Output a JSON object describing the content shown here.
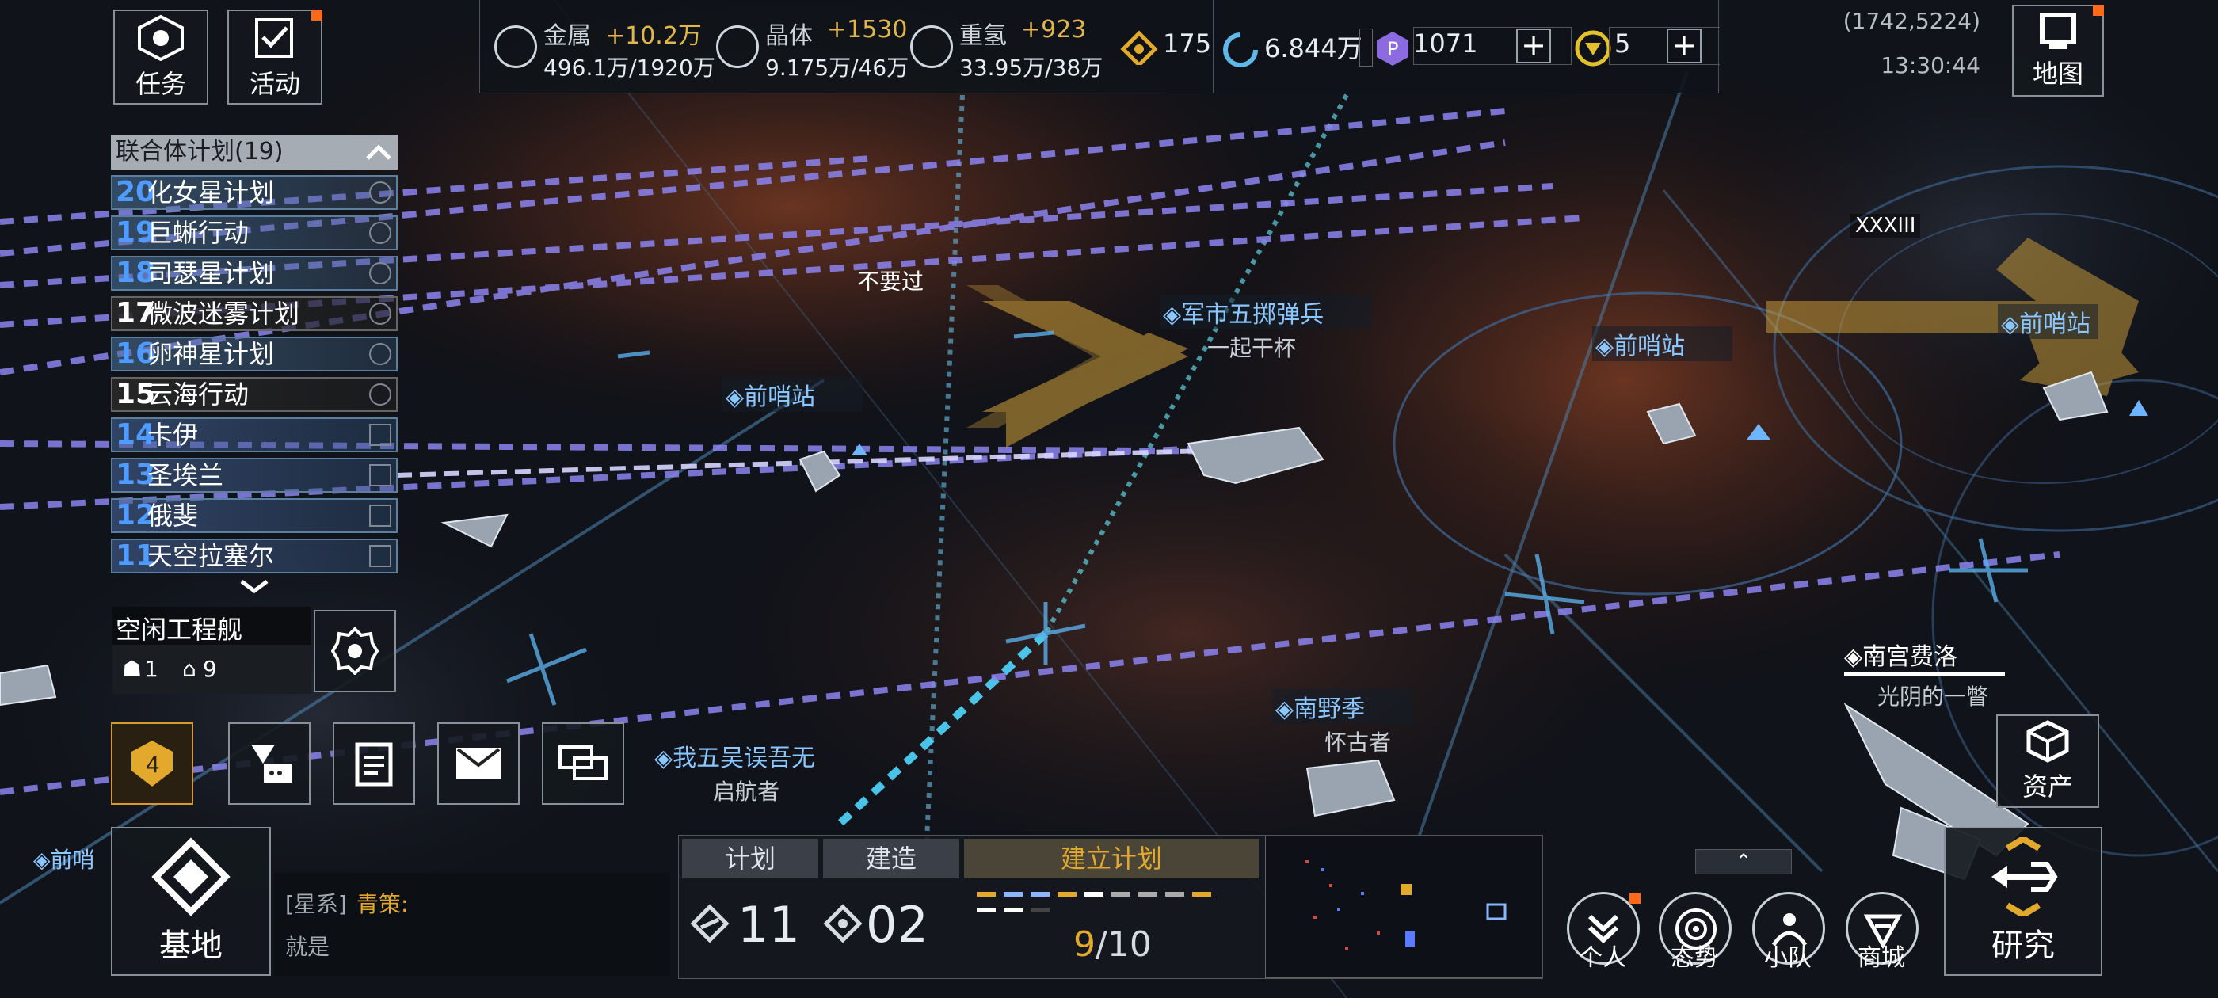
{
  "topleft": {
    "task_label": "任务",
    "activity_label": "活动"
  },
  "resources": [
    {
      "name": "金属",
      "delta": "+10.2万",
      "amount": "496.1万/1920万"
    },
    {
      "name": "晶体",
      "delta": "+1530",
      "amount": "9.175万/46万"
    },
    {
      "name": "重氢",
      "delta": "+923",
      "amount": "33.95万/38万"
    }
  ],
  "currencies": {
    "c1": "175",
    "c2": "6.844万",
    "c3": "1071",
    "c4": "5"
  },
  "coords": {
    "position": "(1742,5224)",
    "time": "13:30:44"
  },
  "map_button_label": "地图",
  "plan_list": {
    "header": "联合体计划(19)",
    "items": [
      {
        "num": "20",
        "name": "化女星计划"
      },
      {
        "num": "19",
        "name": "巨蜥行动"
      },
      {
        "num": "18",
        "name": "司瑟星计划"
      },
      {
        "num": "17",
        "name": "微波迷雾计划"
      },
      {
        "num": "16",
        "name": "卵神星计划"
      },
      {
        "num": "15",
        "name": "云海行动"
      },
      {
        "num": "14",
        "name": "卡伊"
      },
      {
        "num": "13",
        "name": "圣埃兰"
      },
      {
        "num": "12",
        "name": "俄斐"
      },
      {
        "num": "11",
        "name": "天空拉塞尔"
      }
    ]
  },
  "idle_engineer": {
    "title": "空闲工程舰",
    "count_a": "1",
    "count_b": "9"
  },
  "map_labels": {
    "dont_pass": "不要过",
    "outpost_1": "前哨站",
    "junshi": "军市五掷弹兵",
    "junshi_sub": "一起干杯",
    "outpost_2": "前哨站",
    "roman": "XXXIII",
    "outpost_3": "前哨站",
    "nangong": "南宫费洛",
    "nangong_sub": "光阴的一瞥",
    "nanye": "南野季",
    "nanye_sub": "怀古者",
    "wowu": "我五吴误吾无",
    "wowu_sub": "启航者",
    "outpost_left": "前哨"
  },
  "left_toolbar": {
    "level_badge": "4"
  },
  "base_label": "基地",
  "chat": {
    "channel": "[星系]",
    "user": "青策:",
    "message": "就是"
  },
  "bottom_panel": {
    "tab_plan": "计划",
    "tab_build": "建造",
    "tab_establish": "建立计划",
    "plan_count": "11",
    "build_count": "02",
    "establish_current": "9",
    "establish_total": "/10"
  },
  "right_buttons": {
    "assets": "资产",
    "personal": "个人",
    "situation": "态势",
    "squad": "小队",
    "shop": "商城",
    "research": "研究"
  },
  "colors": {
    "accent_gold": "#e3a92c",
    "dash_lavender": "#8c84f0",
    "label_blue": "#8ac6ff"
  }
}
